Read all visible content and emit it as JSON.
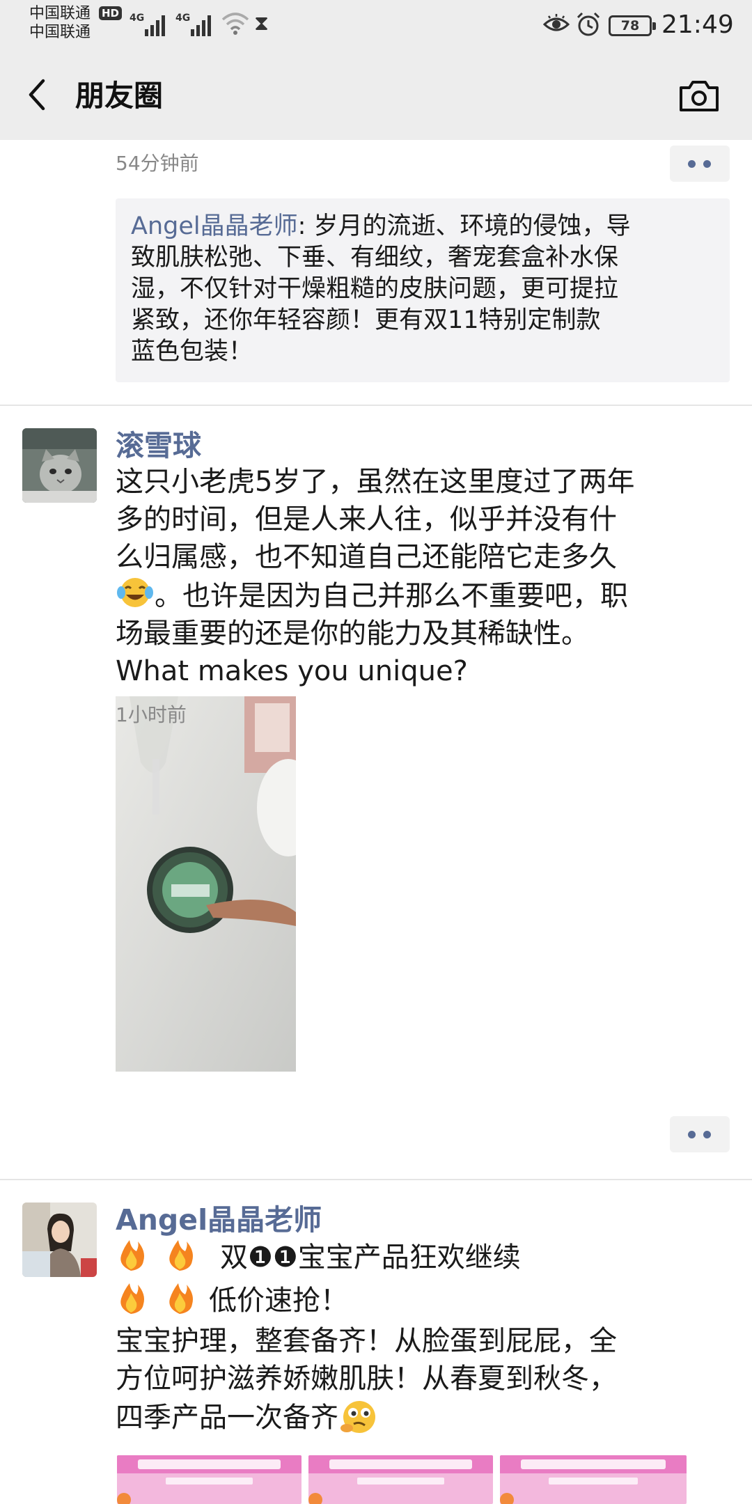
{
  "status_bar": {
    "carrier_1": "中国联通",
    "carrier_2": "中国联通",
    "hd_badge": "HD",
    "signal_1_label": "4G",
    "signal_2_label": "4G",
    "battery_level": "78",
    "time": "21:49"
  },
  "title_bar": {
    "title": "朋友圈",
    "back_icon": "chevron-left-icon",
    "camera_icon": "camera-icon"
  },
  "post_1": {
    "time": "54分钟前",
    "comment_author": "Angel晶晶老师",
    "comment_sep": ":",
    "comment_lines": [
      " 岁月的流逝、环境的侵蚀，导",
      "致肌肤松弛、下垂、有细纹，奢宠套盒补水保",
      "湿，不仅针对干燥粗糙的皮肤问题，更可提拉",
      "紧致，还你年轻容颜！更有双11特别定制款",
      "蓝色包装！"
    ]
  },
  "post_2": {
    "author": "滚雪球",
    "text_lines": [
      "这只小老虎5岁了，虽然在这里度过了两年",
      "多的时间，但是人来人往，似乎并没有什",
      "么归属感，也不知道自己还能陪它走多久",
      "。也许是因为自己并那么不重要吧，职",
      "场最重要的还是你的能力及其稀缺性。",
      "What makes you unique?"
    ],
    "time": "1小时前"
  },
  "post_3": {
    "author": "Angel晶晶老师",
    "line_1": "双❶❶宝宝产品狂欢继续",
    "line_2": "低价速抢！",
    "line_3": "宝宝护理，整套备齐！从脸蛋到屁屁，全",
    "line_4": "方位呵护滋养娇嫩肌肤！从春夏到秋冬，",
    "line_5": "四季产品一次备齐"
  },
  "colors": {
    "link_blue": "#576b95",
    "header_bg": "#ededed",
    "comment_bg": "#f3f3f5"
  }
}
